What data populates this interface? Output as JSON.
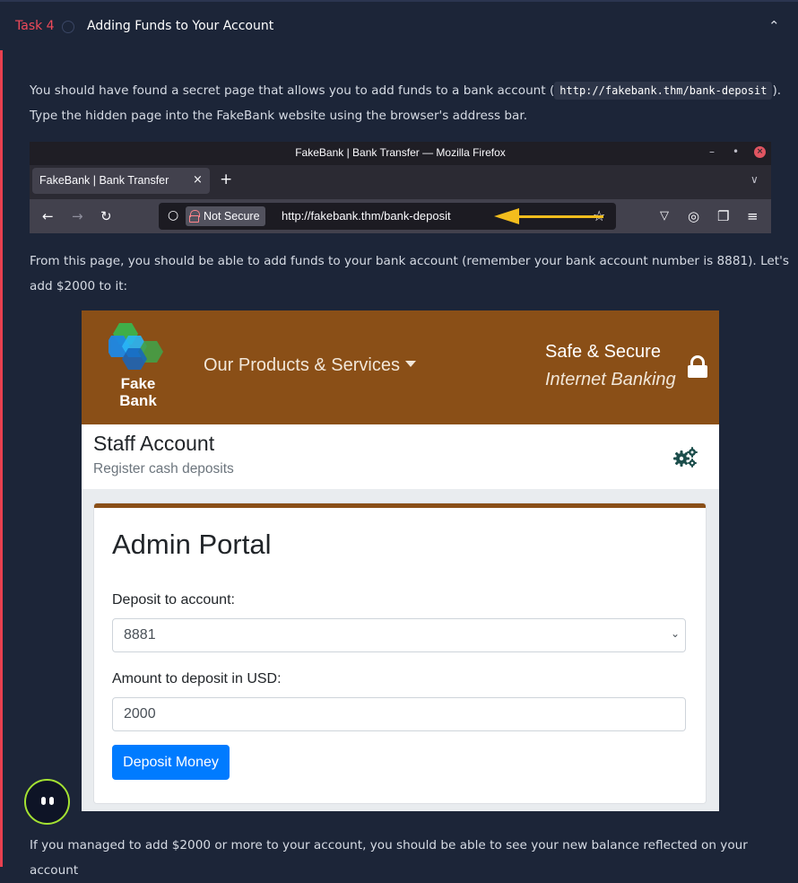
{
  "task": {
    "label": "Task 4",
    "title": "Adding Funds to Your Account",
    "collapse_icon": "chevron-up-icon"
  },
  "intro": {
    "text_before": "You should have found a secret page that allows you to add funds to a bank account (",
    "code": "http://fakebank.thm/bank-deposit",
    "text_after": ").",
    "line2": "Type the hidden page into the FakeBank website using the browser's address bar."
  },
  "browser": {
    "window_title": "FakeBank | Bank Transfer — Mozilla Firefox",
    "tab_label": "FakeBank | Bank Transfer",
    "tab_close": "×",
    "new_tab": "+",
    "not_secure": "Not Secure",
    "url": "http://fakebank.thm/bank-deposit",
    "arrow_color": "#f3bd1d"
  },
  "para2": {
    "line1": "From this page, you should be able to add funds to your bank account (remember your bank account number is 8881). Let's",
    "line2": "add $2000 to it:"
  },
  "fakebank": {
    "logo_line1": "Fake",
    "logo_line2": "Bank",
    "products": "Our Products & Services",
    "safe": "Safe & Secure",
    "internet": "Internet Banking",
    "header_color": "#8a4f17",
    "staff_title": "Staff Account",
    "staff_sub": "Register cash deposits",
    "card_title": "Admin Portal",
    "deposit_label": "Deposit to account:",
    "deposit_value": "8881",
    "amount_label": "Amount to deposit in USD:",
    "amount_value": "2000",
    "button": "Deposit Money",
    "button_color": "#007bff"
  },
  "para3": {
    "line1": "If you managed to add $2000 or more to your account, you should be able to see your new balance reflected on your account"
  }
}
